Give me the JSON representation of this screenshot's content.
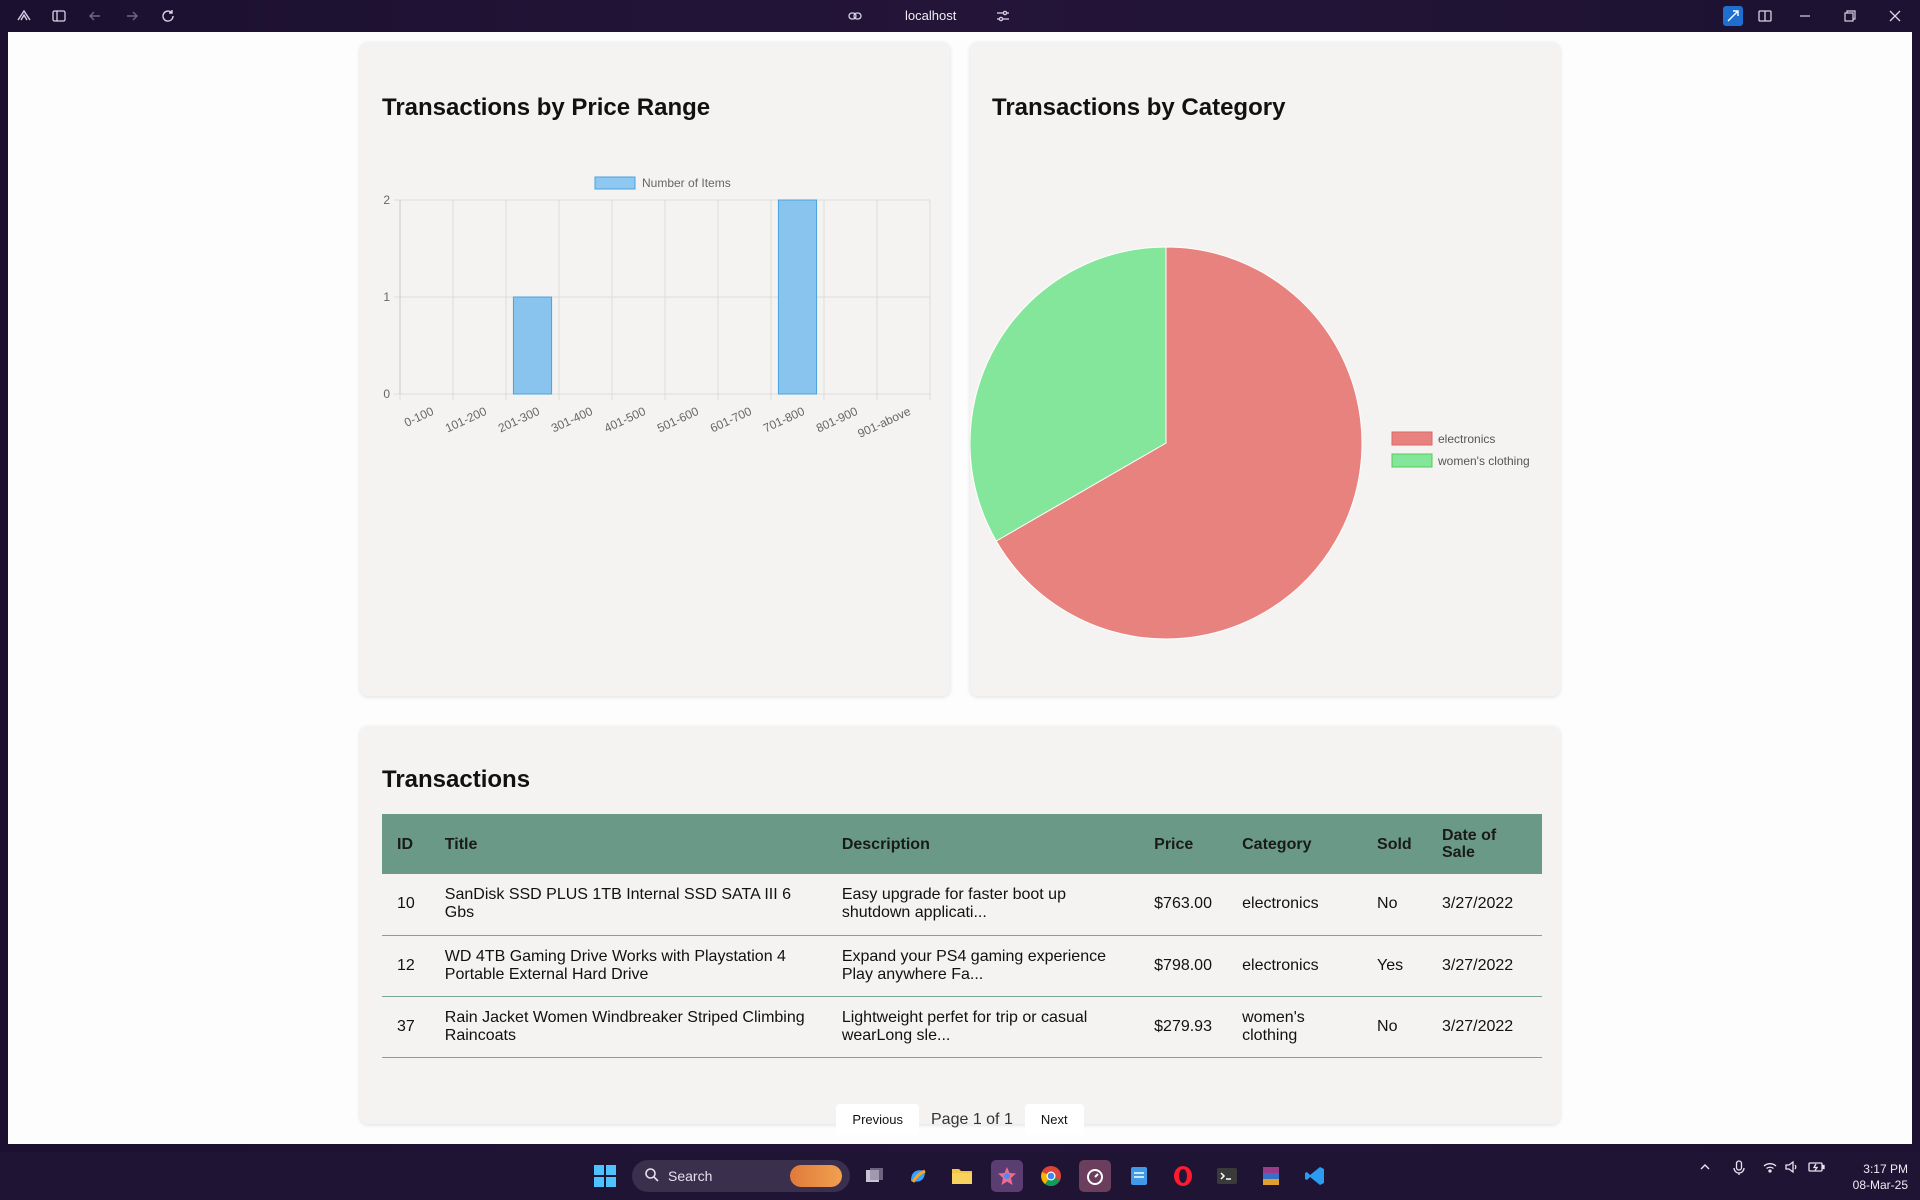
{
  "browser": {
    "url": "localhost"
  },
  "bar_card": {
    "title": "Transactions by Price Range"
  },
  "pie_card": {
    "title": "Transactions by Category"
  },
  "chart_data": [
    {
      "type": "bar",
      "title": "Transactions by Price Range",
      "categories": [
        "0-100",
        "101-200",
        "201-300",
        "301-400",
        "401-500",
        "501-600",
        "601-700",
        "701-800",
        "801-900",
        "901-above"
      ],
      "series": [
        {
          "name": "Number of Items",
          "values": [
            0,
            0,
            1,
            0,
            0,
            0,
            0,
            2,
            0,
            0
          ],
          "color": "#88c4ee"
        }
      ],
      "yticks": [
        "0",
        "1",
        "2"
      ],
      "ylim": [
        0,
        2
      ],
      "grid": true,
      "legend": "top"
    },
    {
      "type": "pie",
      "title": "Transactions by Category",
      "labels": [
        "electronics",
        "women's clothing"
      ],
      "values": [
        2,
        1
      ],
      "colors": [
        "#e8827f",
        "#84e69a"
      ],
      "legend": "right"
    }
  ],
  "transactions": {
    "title": "Transactions",
    "columns": [
      "ID",
      "Title",
      "Description",
      "Price",
      "Category",
      "Sold",
      "Date of Sale"
    ],
    "rows": [
      {
        "id": "10",
        "title": "SanDisk SSD PLUS 1TB Internal SSD SATA III 6 Gbs",
        "description": "Easy upgrade for faster boot up shutdown applicati...",
        "price": "$763.00",
        "category": "electronics",
        "sold": "No",
        "date": "3/27/2022"
      },
      {
        "id": "12",
        "title": "WD 4TB Gaming Drive Works with Playstation 4 Portable External Hard Drive",
        "description": "Expand your PS4 gaming experience Play anywhere Fa...",
        "price": "$798.00",
        "category": "electronics",
        "sold": "Yes",
        "date": "3/27/2022"
      },
      {
        "id": "37",
        "title": "Rain Jacket Women Windbreaker Striped Climbing Raincoats",
        "description": "Lightweight perfet for trip or casual wearLong sle...",
        "price": "$279.93",
        "category": "women's clothing",
        "sold": "No",
        "date": "3/27/2022"
      }
    ],
    "pagination": {
      "previous": "Previous",
      "info": "Page 1 of 1",
      "next": "Next"
    }
  },
  "taskbar": {
    "search_label": "Search",
    "time": "3:17 PM",
    "date": "08-Mar-25"
  }
}
